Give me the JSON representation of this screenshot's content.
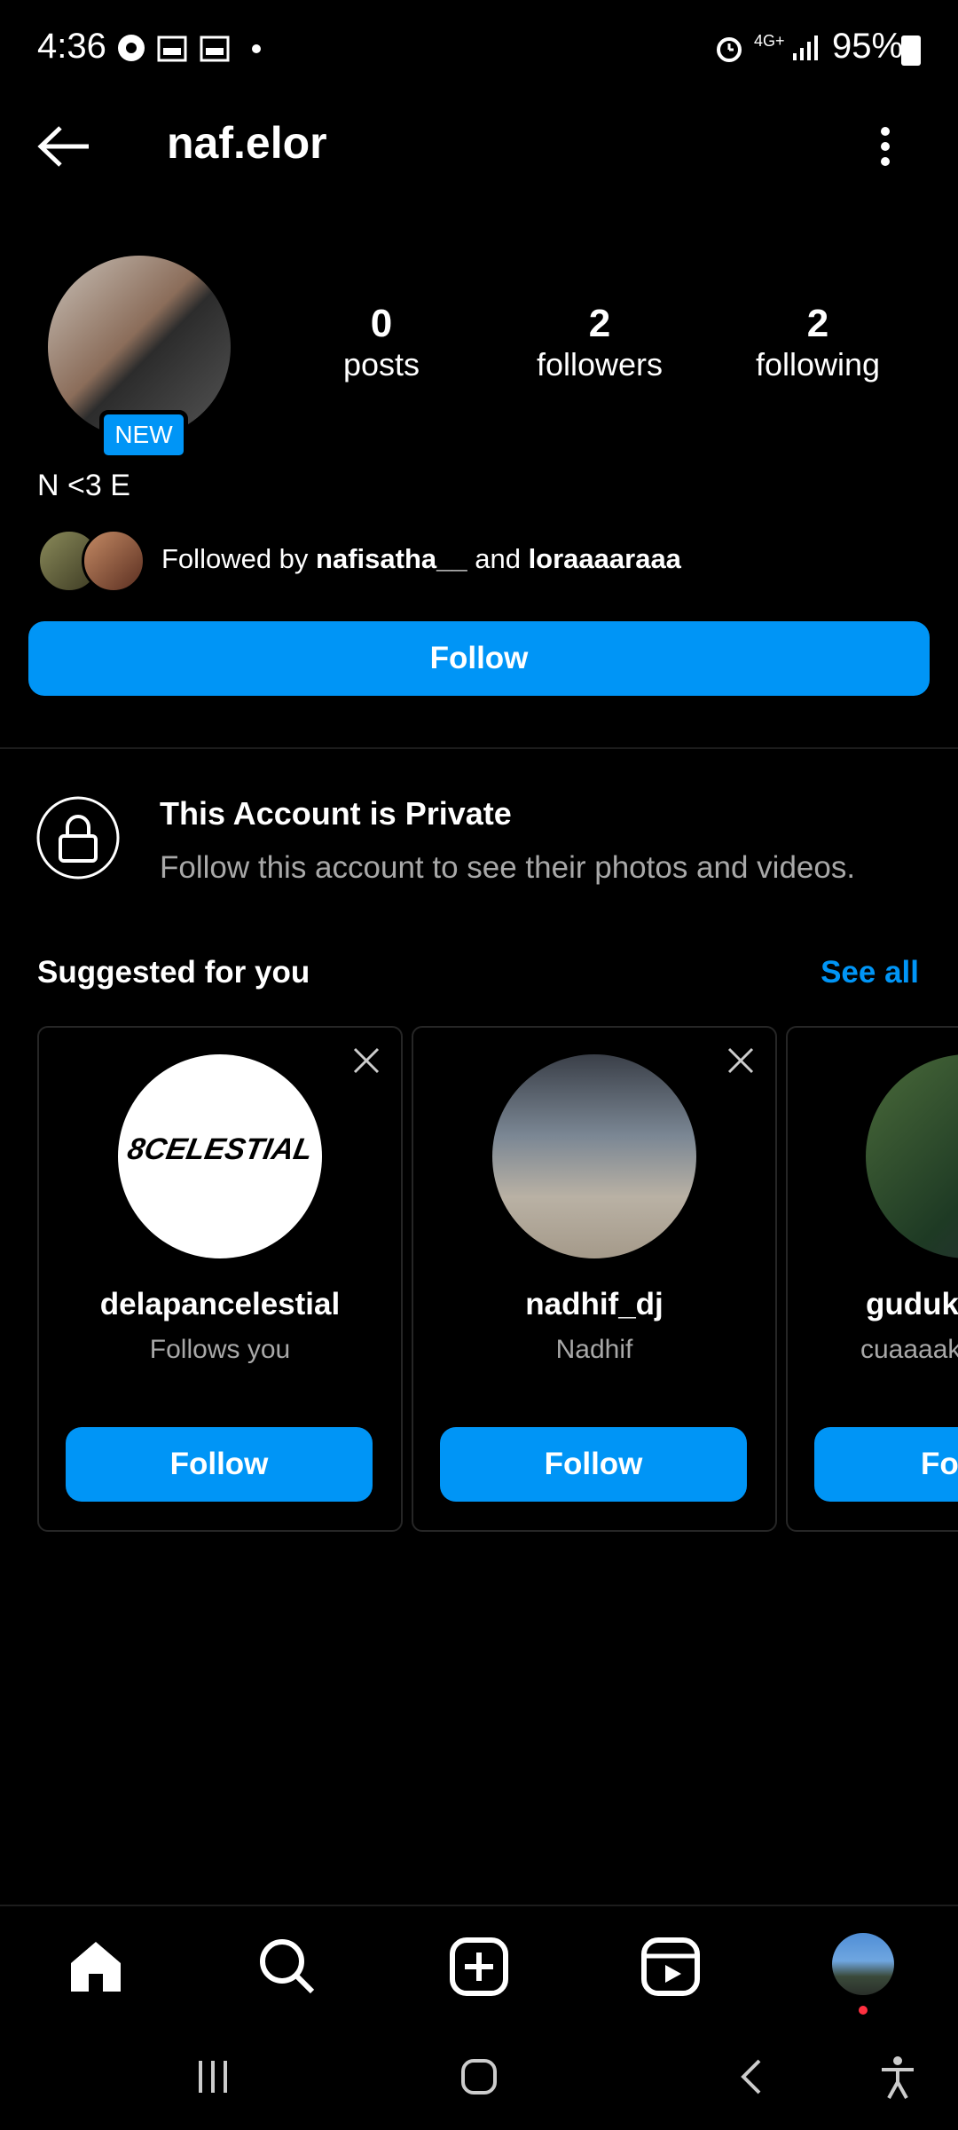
{
  "status_bar": {
    "time": "4:36",
    "network": "4G+",
    "battery": "95%"
  },
  "header": {
    "username": "naf.elor",
    "back_icon": "arrow-left-icon",
    "more_icon": "vertical-dots-icon"
  },
  "profile": {
    "badge": "NEW",
    "stats": [
      {
        "value": "0",
        "label": "posts"
      },
      {
        "value": "2",
        "label": "followers"
      },
      {
        "value": "2",
        "label": "following"
      }
    ],
    "bio": "N <3 E",
    "followed_by_prefix": "Followed by ",
    "followed_by_user1": "nafisatha__",
    "followed_by_and": " and ",
    "followed_by_user2": "loraaaaraaa",
    "follow_label": "Follow"
  },
  "private": {
    "title": "This Account is Private",
    "subtitle": "Follow this account to see their photos and videos."
  },
  "suggested": {
    "title": "Suggested for you",
    "see_all": "See all",
    "cards": [
      {
        "name": "delapancelestial",
        "sub": "Follows you",
        "button": "Follow",
        "avatar_text": "8CELESTIAL"
      },
      {
        "name": "nadhif_dj",
        "sub": "Nadhif",
        "button": "Follow"
      },
      {
        "name": "guduk",
        "sub": "cuaaaak",
        "button": "Fo"
      }
    ]
  },
  "colors": {
    "accent": "#0095f6",
    "background": "#000000",
    "secondary_text": "#a8a8a8"
  }
}
